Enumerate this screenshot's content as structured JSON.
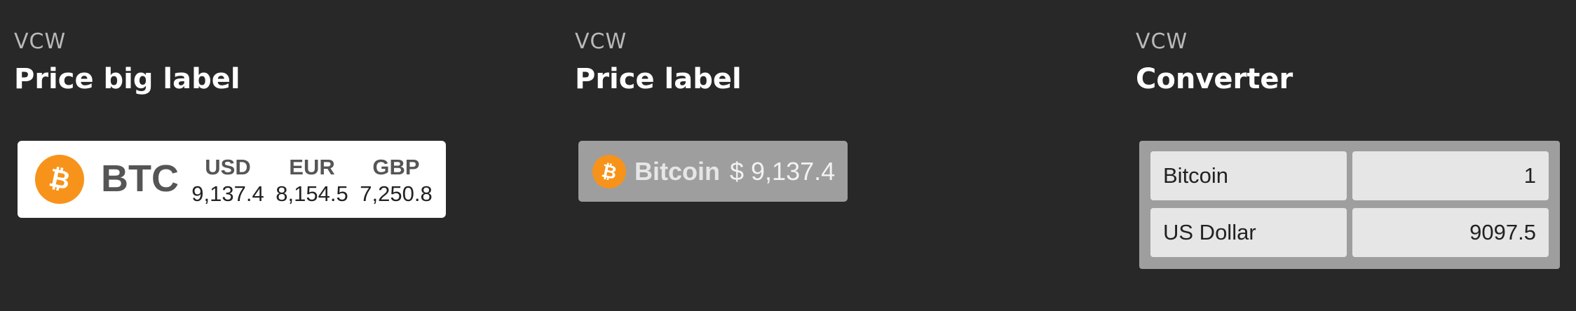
{
  "widgets": [
    {
      "eyebrow": "VCW",
      "title": "Price big label",
      "card": {
        "icon": "bitcoin-icon",
        "symbol": "BTC",
        "currencies": [
          {
            "code": "USD",
            "value": "9,137.4"
          },
          {
            "code": "EUR",
            "value": "8,154.5"
          },
          {
            "code": "GBP",
            "value": "7,250.8"
          }
        ]
      }
    },
    {
      "eyebrow": "VCW",
      "title": "Price label",
      "card": {
        "icon": "bitcoin-icon",
        "name": "Bitcoin",
        "price": "$ 9,137.4"
      }
    },
    {
      "eyebrow": "VCW",
      "title": "Converter",
      "card": {
        "rows": [
          {
            "currency": "Bitcoin",
            "amount": "1"
          },
          {
            "currency": "US Dollar",
            "amount": "9097.5"
          }
        ]
      }
    }
  ],
  "colors": {
    "page_background": "#282828",
    "bitcoin_orange": "#f7931a",
    "card_gray": "#9e9e9e",
    "field_background": "#e6e6e6"
  }
}
